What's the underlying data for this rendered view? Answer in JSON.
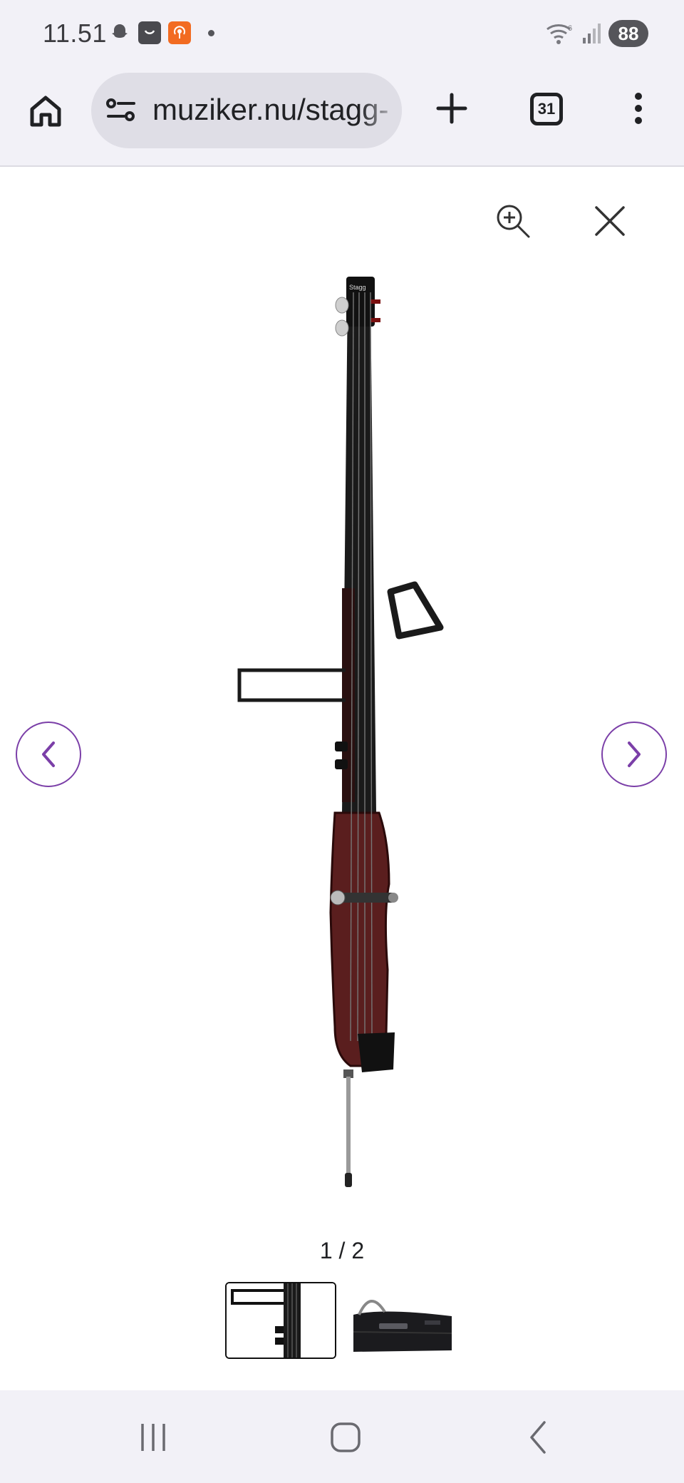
{
  "status_bar": {
    "time": "11.51",
    "battery": "88",
    "notification_icons": [
      "snapchat-icon",
      "shopping-bag-icon",
      "podcast-icon"
    ]
  },
  "browser": {
    "url": "muziker.nu/stagg-",
    "tab_count": "31"
  },
  "gallery": {
    "counter": "1 / 2",
    "current_index": 1,
    "total": 2,
    "thumbnails": [
      {
        "name": "electric-upright-bass-closeup",
        "selected": true
      },
      {
        "name": "gig-bag",
        "selected": false
      }
    ],
    "nav_accent_color": "#7b3fa8"
  },
  "product_image": {
    "subject": "electric upright bass",
    "headstock_logo": "Stagg",
    "body_color": "#5a1e1e",
    "neck_color": "#1a1a1a"
  }
}
